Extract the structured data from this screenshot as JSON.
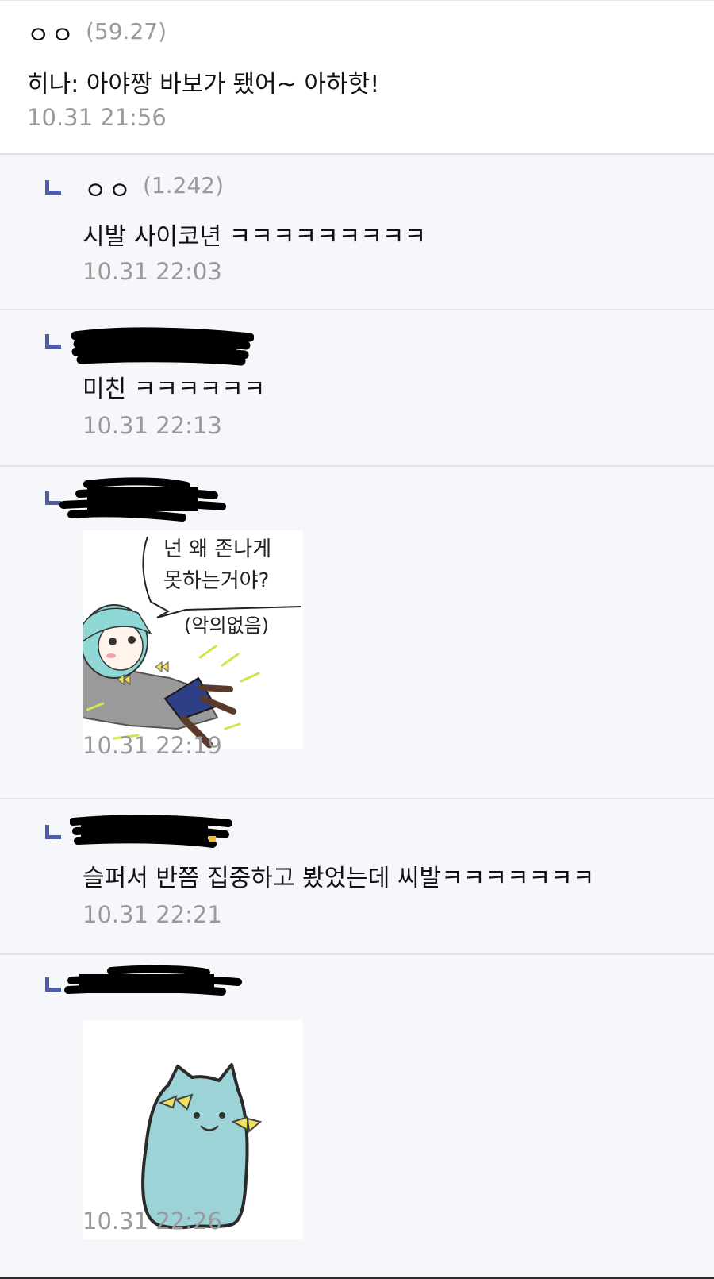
{
  "comments": [
    {
      "nickname": "ㅇㅇ",
      "ip": "(59.27)",
      "text": "히나: 아야짱 바보가 됐어~ 아하핫!",
      "time": "10.31 21:56"
    }
  ],
  "replies": [
    {
      "nickname": "ㅇㅇ",
      "ip": "(1.242)",
      "text": "시발 사이코년 ㅋㅋㅋㅋㅋㅋㅋㅋㅋ",
      "time": "10.31 22:03"
    },
    {
      "nickname_redacted": true,
      "text": "미친 ㅋㅋㅋㅋㅋㅋ",
      "time": "10.31 22:13"
    },
    {
      "nickname_redacted": true,
      "sticker": {
        "kind": "cartoon-girl-lying",
        "speech_line1": "넌 왜 존나게",
        "speech_line2": "못하는거야?",
        "caption": "(악의없음)"
      },
      "time": "10.31 22:19"
    },
    {
      "nickname_redacted": true,
      "text": "슬퍼서 반쯤 집중하고 봤었는데 씨발ㅋㅋㅋㅋㅋㅋㅋ",
      "time": "10.31 22:21"
    },
    {
      "nickname_redacted": true,
      "sticker": {
        "kind": "teal-ghost-cat"
      },
      "time": "10.31 22:26"
    }
  ],
  "colors": {
    "reply_bg": "#f6f7fb",
    "reply_arrow": "#4f5da8",
    "timestamp": "#9a9a9a",
    "redaction": "#000000",
    "sticker_teal": "#9cd3d6",
    "ribbon_yellow": "#f0e060"
  }
}
